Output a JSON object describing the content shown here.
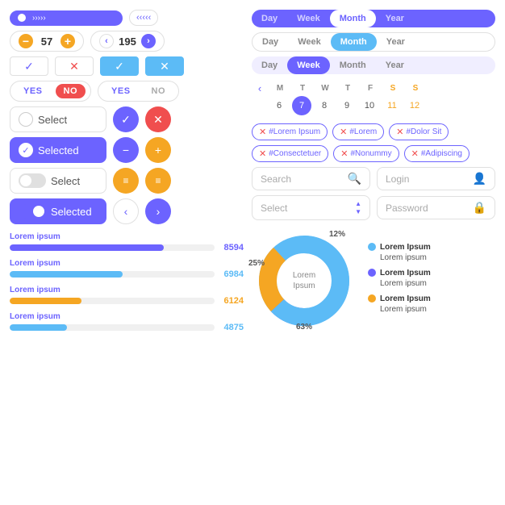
{
  "pagination": {
    "dots": [
      true,
      false,
      false,
      false
    ],
    "arrows": [
      "›",
      "›",
      "›",
      "›",
      "›"
    ]
  },
  "steppers": [
    {
      "value": "57",
      "type": "plusminus"
    },
    {
      "value": "195",
      "type": "arrow"
    }
  ],
  "checkboxes": [
    {
      "checked": false,
      "type": "outline"
    },
    {
      "checked": false,
      "icon": "x",
      "color": "red"
    },
    {
      "checked": true,
      "color": "blue"
    },
    {
      "checked": false,
      "icon": "x",
      "color": "white"
    }
  ],
  "yesno": [
    {
      "yes": "YES",
      "no": "NO",
      "active": "no"
    },
    {
      "yes": "YES",
      "no": "NO",
      "active": "yes"
    }
  ],
  "selects": [
    {
      "label": "Select",
      "selected": false
    },
    {
      "label": "Selected",
      "selected": true
    },
    {
      "label": "Select",
      "selected": false,
      "type": "toggle"
    },
    {
      "label": "Selected",
      "selected": true,
      "type": "toggle"
    }
  ],
  "iconButtons": [
    {
      "icon": "✓",
      "style": "purple"
    },
    {
      "icon": "✕",
      "style": "red"
    },
    {
      "icon": "−",
      "style": "purple"
    },
    {
      "icon": "+",
      "style": "orange"
    },
    {
      "icon": "≡",
      "style": "orange"
    },
    {
      "icon": "≡",
      "style": "orange"
    },
    {
      "icon": "‹",
      "style": "white-border"
    },
    {
      "icon": "›",
      "style": "purple"
    }
  ],
  "progressBars": [
    {
      "label": "Lorem ipsum",
      "value": 75,
      "displayVal": "8594",
      "color": "#6c63ff"
    },
    {
      "label": "Lorem ipsum",
      "value": 55,
      "displayVal": "6984",
      "color": "#5cbbf6"
    },
    {
      "label": "Lorem ipsum",
      "value": 35,
      "displayVal": "6124",
      "color": "#f5a623"
    },
    {
      "label": "Lorem ipsum",
      "value": 28,
      "displayVal": "4875",
      "color": "#5cbbf6"
    }
  ],
  "tabs": [
    {
      "style": "dark",
      "items": [
        "Day",
        "Week",
        "Month",
        "Year"
      ],
      "active": "Month"
    },
    {
      "style": "light",
      "items": [
        "Day",
        "Week",
        "Month",
        "Year"
      ],
      "active": "Month"
    },
    {
      "style": "mid",
      "items": [
        "Day",
        "Week",
        "Month",
        "Year"
      ],
      "active": "Week"
    }
  ],
  "calendar": {
    "headers": [
      "M",
      "T",
      "W",
      "T",
      "F",
      "S",
      "S"
    ],
    "days": [
      6,
      7,
      8,
      9,
      10,
      11,
      12
    ],
    "active": 7,
    "orangeDays": [
      11,
      12
    ]
  },
  "tags": [
    {
      "text": "#Lorem Ipsum"
    },
    {
      "text": "#Lorem"
    },
    {
      "text": "#Dolor Sit"
    },
    {
      "text": "#Consectetuer"
    },
    {
      "text": "#Nonummy"
    },
    {
      "text": "#Adipiscing"
    }
  ],
  "inputs": [
    {
      "placeholder": "Search",
      "icon": "🔍",
      "type": "search"
    },
    {
      "placeholder": "Login",
      "icon": "👤",
      "type": "login"
    },
    {
      "placeholder": "Select",
      "icon": "⬍",
      "type": "select"
    },
    {
      "placeholder": "Password",
      "icon": "🔒",
      "type": "password"
    }
  ],
  "donut": {
    "segments": [
      {
        "label": "Lorem Ipsum",
        "sublabel": "Lorem ipsum",
        "color": "#5cbbf6",
        "percent": 63
      },
      {
        "label": "Lorem Ipsum",
        "sublabel": "Lorem ipsum",
        "color": "#6c63ff",
        "percent": 12
      },
      {
        "label": "Lorem Ipsum",
        "sublabel": "Lorem ipsum",
        "color": "#f5a623",
        "percent": 25
      }
    ],
    "centerText": "Lorem\nIpsum",
    "labels": [
      "12%",
      "25%",
      "63%"
    ]
  }
}
